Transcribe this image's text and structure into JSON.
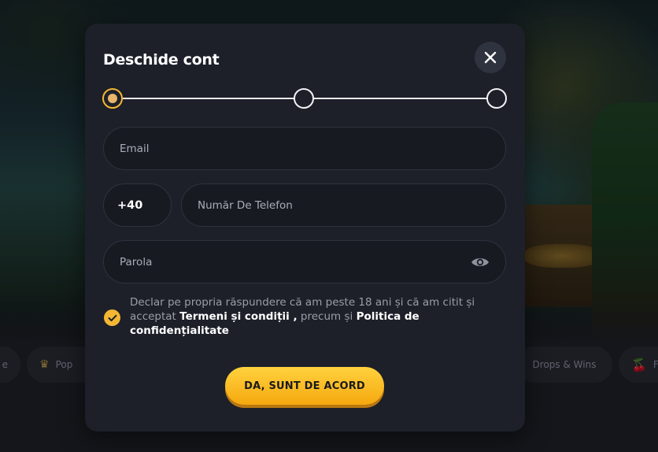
{
  "modal": {
    "title": "Deschide cont",
    "close_icon": "close-icon",
    "stepper": {
      "steps": 3,
      "current": 1
    }
  },
  "form": {
    "email_placeholder": "Email",
    "phone_prefix": "+40",
    "phone_placeholder": "Număr De Telefon",
    "password_placeholder": "Parola",
    "password_toggle_icon": "eye-icon"
  },
  "consent": {
    "checked": true,
    "text_part1": "Declar pe propria răspundere că am peste 18 ani și că am citit și acceptat ",
    "terms_link": "Termeni și condiții ,",
    "text_part2": " precum și ",
    "privacy_link": "Politica de confidențialitate"
  },
  "submit": {
    "label": "DA, SUNT DE ACORD"
  },
  "background": {
    "pills": [
      {
        "label": "e"
      },
      {
        "label": "Pop",
        "icon": "crown-icon"
      },
      {
        "label": "Drops & Wins"
      },
      {
        "label": "F",
        "icon": "cherry-icon"
      }
    ]
  },
  "colors": {
    "accent": "#f4b733",
    "modal_bg": "#1d2029",
    "field_bg": "#171a21"
  }
}
